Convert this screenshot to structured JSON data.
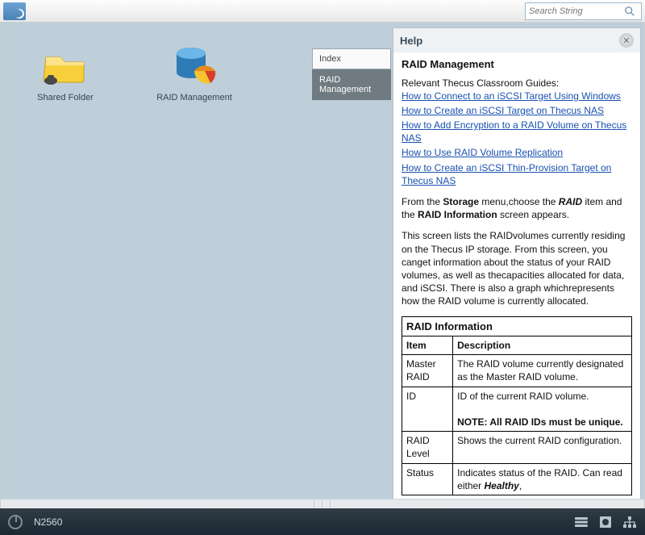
{
  "header": {
    "search_placeholder": "Search String"
  },
  "desktop": {
    "icons": [
      {
        "label": "Shared Folder"
      },
      {
        "label": "RAID Management"
      }
    ]
  },
  "tabs": {
    "index": "Index",
    "raid": "RAID Management"
  },
  "help": {
    "title": "Help",
    "heading": "RAID Management",
    "guides_intro": "Relevant Thecus Classroom Guides:",
    "links": [
      "How to Connect to an iSCSI Target Using Windows",
      "How to Create an iSCSI Target on Thecus NAS",
      "How to Add Encryption to a RAID Volume on Thecus NAS",
      "How to Use RAID Volume Replication",
      "How to Create an iSCSI Thin-Provision Target on Thecus NAS"
    ],
    "para1_a": "From the ",
    "para1_b": "Storage",
    "para1_c": " menu,choose the ",
    "para1_d": "RAID",
    "para1_e": " item and the ",
    "para1_f": "RAID Information",
    "para1_g": " screen appears.",
    "para2": "This screen lists the RAIDvolumes currently residing on the Thecus IP storage. From this screen, you canget information about the status of your RAID volumes, as well as thecapacities allocated for data, and iSCSI. There is also a graph whichrepresents how the RAID volume is currently allocated.",
    "table": {
      "caption": "RAID Information",
      "h1": "Item",
      "h2": "Description",
      "rows": [
        {
          "item": "Master RAID",
          "desc": "The RAID volume currently designated as the Master RAID volume."
        },
        {
          "item": "ID",
          "desc_a": "ID of the current RAID volume.",
          "desc_b": "NOTE: All RAID IDs must be unique."
        },
        {
          "item": "RAID Level",
          "desc": "Shows the current RAID configuration."
        },
        {
          "item": "Status",
          "desc_a": "Indicates status of the RAID. Can read either ",
          "desc_b": "Healthy",
          "desc_c": ","
        }
      ]
    }
  },
  "footer": {
    "model": "N2560"
  }
}
